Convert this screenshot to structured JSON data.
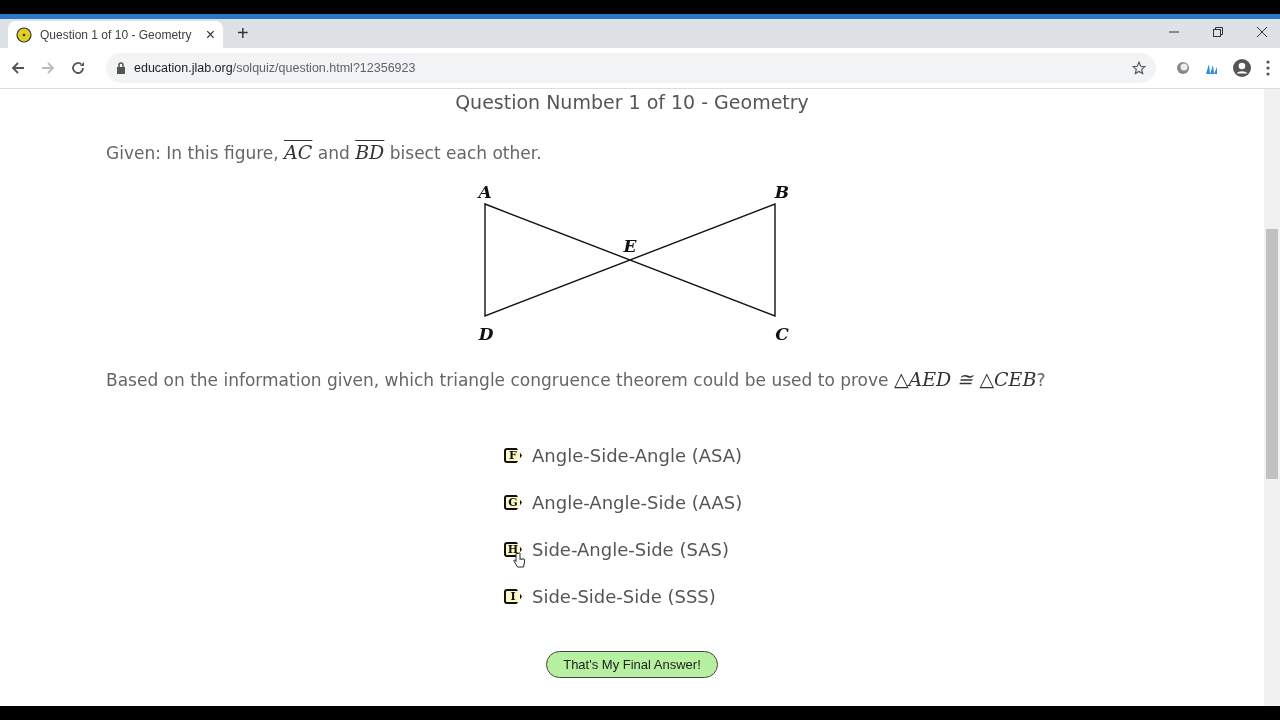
{
  "browser": {
    "tab": {
      "title": "Question 1 of 10 - Geometry",
      "close": "×",
      "new_tab": "+"
    },
    "address": {
      "domain": "education.jlab.org",
      "path": "/solquiz/question.html?12356923"
    }
  },
  "page": {
    "heading": "Question Number 1 of 10 - Geometry",
    "given": [
      {
        "kind": "text",
        "text": "Given: In this figure, "
      },
      {
        "kind": "segment",
        "text": "AC"
      },
      {
        "kind": "text",
        "text": " and "
      },
      {
        "kind": "segment",
        "text": "BD"
      },
      {
        "kind": "text",
        "text": " bisect each other."
      }
    ],
    "figure": {
      "points": [
        {
          "label": "A"
        },
        {
          "label": "B"
        },
        {
          "label": "C"
        },
        {
          "label": "D"
        },
        {
          "label": "E"
        }
      ]
    },
    "question": [
      {
        "kind": "text",
        "text": "Based on the information given, which triangle congruence theorem could be used to prove "
      },
      {
        "kind": "math",
        "text": "△AED ≅ △CEB"
      },
      {
        "kind": "text",
        "text": "?"
      }
    ],
    "choices": [
      {
        "letter": "F",
        "text": "Angle-Side-Angle (ASA)"
      },
      {
        "letter": "G",
        "text": "Angle-Angle-Side (AAS)"
      },
      {
        "letter": "H",
        "text": "Side-Angle-Side (SAS)"
      },
      {
        "letter": "I",
        "text": "Side-Side-Side (SSS)"
      }
    ],
    "submit": "That's My Final Answer!"
  }
}
